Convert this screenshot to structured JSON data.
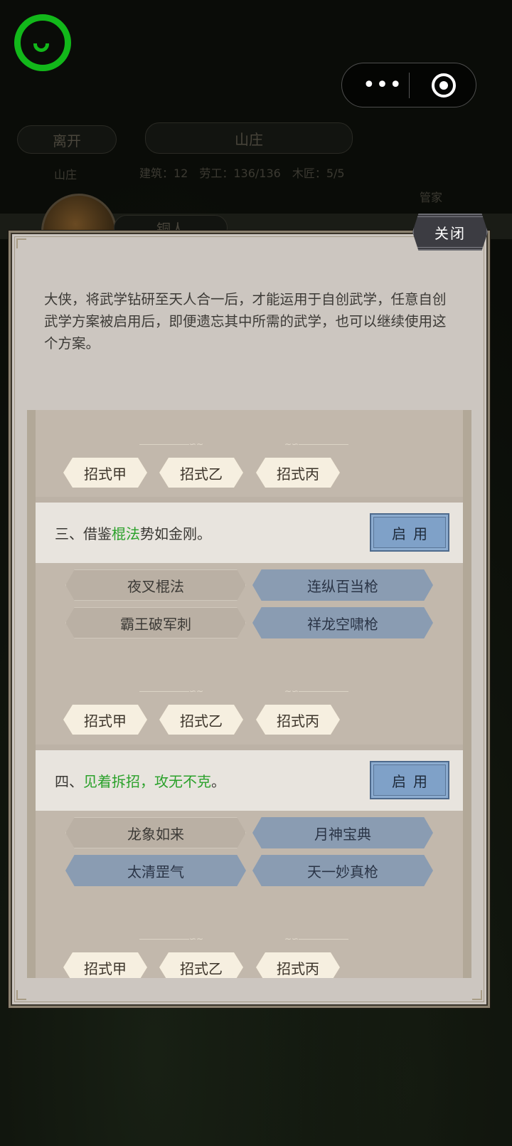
{
  "background": {
    "leave_label": "离开",
    "location_title": "山庄",
    "sub_label": "山庄",
    "stats": "建筑：12　劳工：136/136　木匠：5/5",
    "manage_label": "管家",
    "npc_name": "铜人"
  },
  "dialog": {
    "close_label": "关闭",
    "intro": "大侠，将武学钻研至天人合一后，才能运用于自创武学，任意自创武学方案被启用后，即便遗忘其中所需的武学，也可以继续使用这个方案。"
  },
  "moves": [
    "招式甲",
    "招式乙",
    "招式丙"
  ],
  "plans": [
    {
      "title_prefix": "三、借鉴",
      "title_highlight": "棍法",
      "title_suffix": "势如金刚。",
      "enable_label": "启用",
      "skills": [
        {
          "name": "夜叉棍法",
          "style": "plain"
        },
        {
          "name": "连纵百当枪",
          "style": "blue"
        },
        {
          "name": "霸王破军刺",
          "style": "plain"
        },
        {
          "name": "祥龙空啸枪",
          "style": "blue"
        }
      ]
    },
    {
      "title_prefix": "四、",
      "title_highlight": "见着拆招，攻无不克",
      "title_suffix": "。",
      "enable_label": "启用",
      "skills": [
        {
          "name": "龙象如来",
          "style": "plain"
        },
        {
          "name": "月神宝典",
          "style": "blue"
        },
        {
          "name": "太清罡气",
          "style": "blue"
        },
        {
          "name": "天一妙真枪",
          "style": "blue"
        }
      ]
    }
  ],
  "colors": {
    "highlight_green": "#2aa12a",
    "enable_blue": "#7fa1c8",
    "wechat_green": "#12b81a"
  }
}
